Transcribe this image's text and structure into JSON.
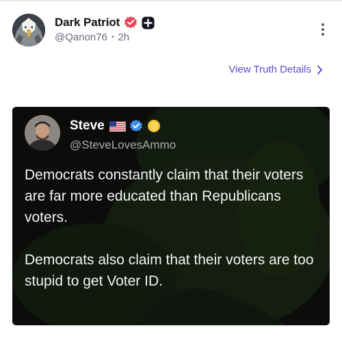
{
  "post": {
    "display_name": "Dark Patriot",
    "handle": "@Qanon76",
    "separator": "•",
    "time": "2h",
    "details_link": "View Truth Details",
    "colors": {
      "accent": "#5b49cf",
      "verify_badge": "#e8445a"
    }
  },
  "quote": {
    "name": "Steve",
    "handle": "@SteveLovesAmmo",
    "text": "Democrats constantly claim that their voters are far more educated than Republicans voters.\n\nDemocrats also claim that their voters are too stupid to get Voter ID.",
    "icons": [
      "us-flag-icon",
      "verified-icon",
      "coin-icon"
    ]
  }
}
